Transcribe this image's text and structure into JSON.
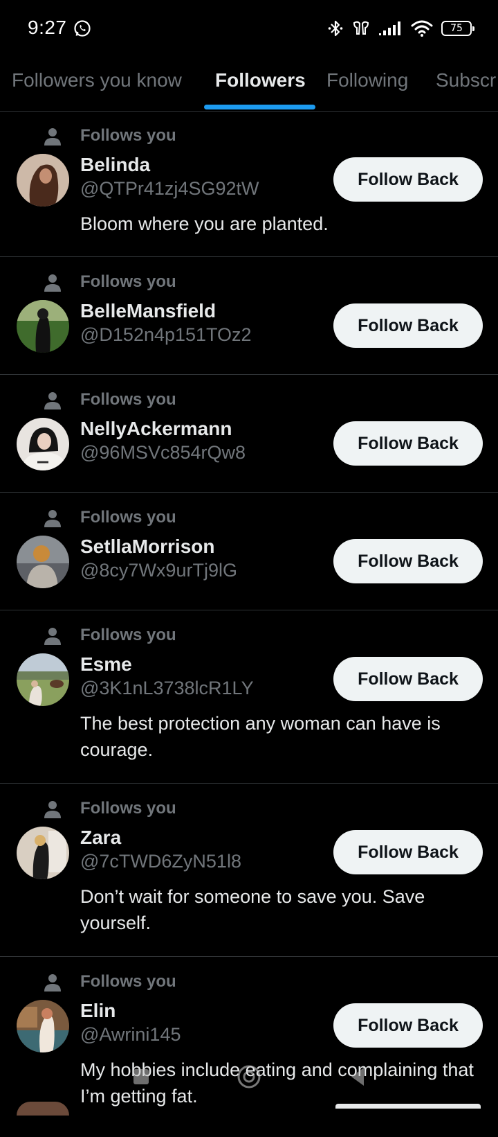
{
  "status_bar": {
    "time": "9:27",
    "battery": "75"
  },
  "tabs": [
    {
      "label": "Followers you know",
      "active": false
    },
    {
      "label": "Followers",
      "active": true
    },
    {
      "label": "Following",
      "active": false
    },
    {
      "label": "Subscr",
      "active": false
    }
  ],
  "followers": [
    {
      "follows_label": "Follows you",
      "name": "Belinda",
      "handle": "@QTPr41zj4SG92tW",
      "bio": "Bloom where you are planted.",
      "button": "Follow Back"
    },
    {
      "follows_label": "Follows you",
      "name": "BelleMansfield",
      "handle": "@D152n4p151TOz2",
      "bio": "",
      "button": "Follow Back"
    },
    {
      "follows_label": "Follows you",
      "name": "NellyAckermann",
      "handle": "@96MSVc854rQw8",
      "bio": "",
      "button": "Follow Back"
    },
    {
      "follows_label": "Follows you",
      "name": "SetllaMorrison",
      "handle": "@8cy7Wx9urTj9lG",
      "bio": "",
      "button": "Follow Back"
    },
    {
      "follows_label": "Follows you",
      "name": "Esme",
      "handle": "@3K1nL3738lcR1LY",
      "bio": "The best protection any woman can have is courage.",
      "button": "Follow Back"
    },
    {
      "follows_label": "Follows you",
      "name": "Zara",
      "handle": "@7cTWD6ZyN51l8",
      "bio": "Don’t wait for someone to save you. Save yourself.",
      "button": "Follow Back"
    },
    {
      "follows_label": "Follows you",
      "name": "Elin",
      "handle": "@Awrini145",
      "bio": "My hobbies include eating and complaining that I’m getting fat.",
      "button": "Follow Back"
    }
  ],
  "colors": {
    "background": "#000000",
    "accent": "#1d9bf0",
    "secondary_text": "#71767b",
    "button_bg": "#eff3f4"
  },
  "icons": [
    "whatsapp-icon",
    "bluetooth-icon",
    "earbuds-icon",
    "signal-icon",
    "wifi-icon",
    "battery-icon",
    "person-icon",
    "nav-recents-icon",
    "nav-home-icon",
    "nav-back-icon"
  ]
}
